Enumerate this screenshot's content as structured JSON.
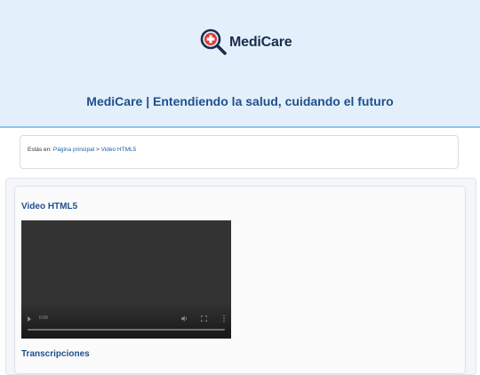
{
  "header": {
    "logo_text": "MediCare",
    "tagline": "MediCare | Entendiendo la salud, cuidando el futuro"
  },
  "breadcrumb": {
    "prefix": "Estás en:",
    "home": "Página principal",
    "separator": ">",
    "current": "Video HTML5"
  },
  "main": {
    "video_title": "Video HTML5",
    "video": {
      "time": "0:00",
      "progress": 0
    },
    "transcripts_title": "Transcripciones"
  },
  "colors": {
    "header_bg": "#e3f0fb",
    "accent_blue": "#1f4f8c",
    "logo_red": "#e03a3a",
    "logo_dark": "#1a2d4a"
  }
}
